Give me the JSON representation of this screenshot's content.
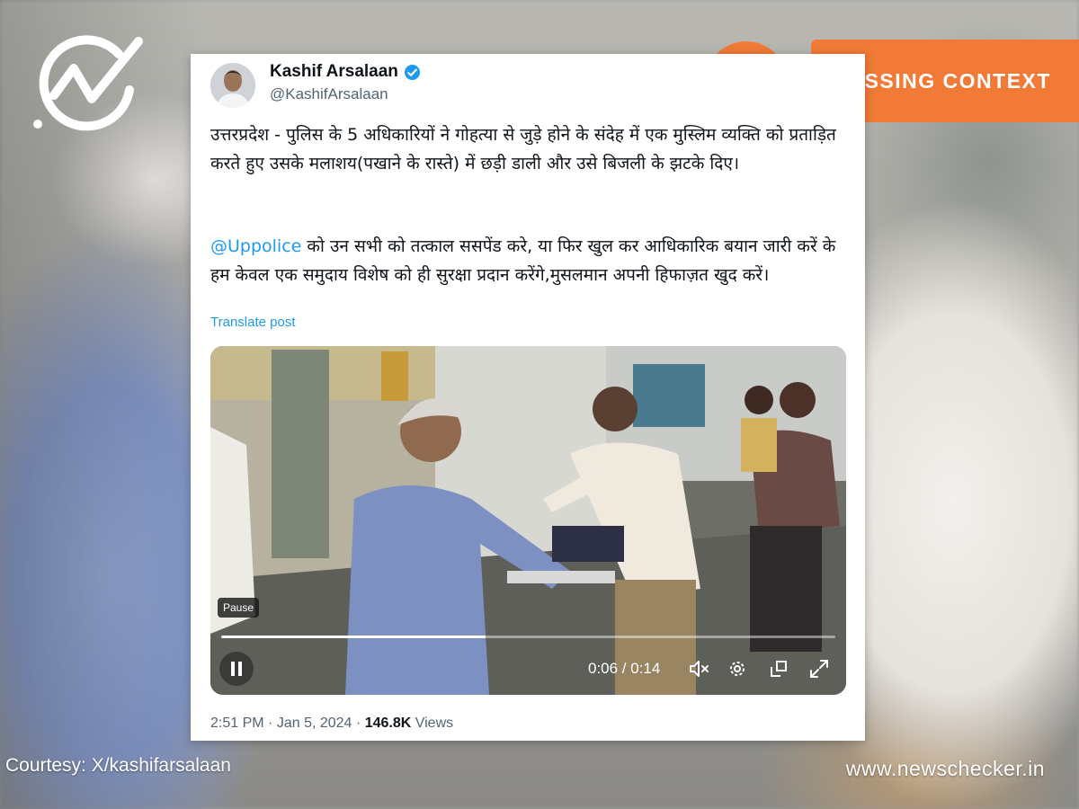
{
  "brand": {
    "logo_icon": "newschecker-check-icon",
    "website": "www.newschecker.in",
    "courtesy": "Courtesy: X/kashifarsalaan"
  },
  "verdict": {
    "label": "MISSING CONTEXT",
    "icon": "magnifier-icon",
    "color": "#f07a36"
  },
  "tweet": {
    "author_name": "Kashif Arsalaan",
    "handle": "@KashifArsalaan",
    "verified": true,
    "paragraph1": "उत्तरप्रदेश - पुलिस के 5 अधिकारियों ने गोहत्या से जुड़े होने के संदेह में एक मुस्लिम व्यक्ति को प्रताड़ित करते हुए उसके मलाशय(पखाने के रास्ते) में छड़ी डाली और उसे बिजली के झटके दिए।",
    "mention": "@Uppolice",
    "paragraph2_rest": " को उन सभी को तत्काल ससपेंड करे, या फिर खुल कर आधिकारिक बयान जारी करें के हम केवल एक समुदाय विशेष को ही सुरक्षा प्रदान करेंगे,मुसलमान अपनी हिफाज़त खुद करें।",
    "translate_label": "Translate post",
    "time": "2:51 PM",
    "date": "Jan 5, 2024",
    "separator": "·",
    "views_count": "146.8K",
    "views_label": "Views",
    "accent_color": "#1d9bf0"
  },
  "video": {
    "tooltip": "Pause",
    "time_display": "0:06 / 0:14",
    "progress": 0.43,
    "controls": [
      "pause-icon",
      "mute-icon",
      "settings-icon",
      "popout-icon",
      "fullscreen-icon"
    ]
  }
}
